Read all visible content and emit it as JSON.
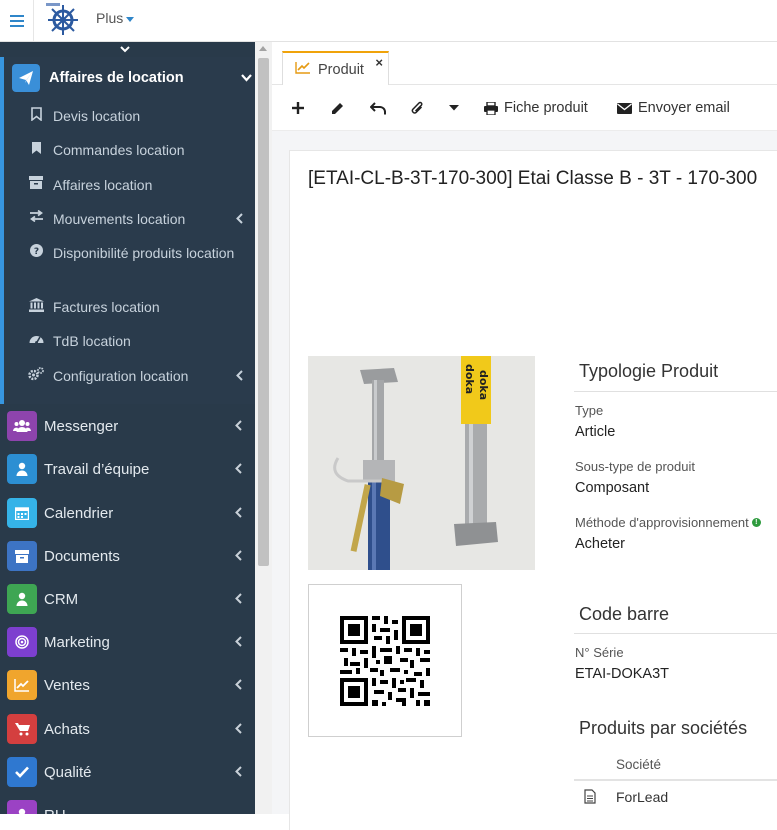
{
  "topbar": {
    "menu_icon": "hamburger-icon",
    "logo_icon": "ship-wheel-logo",
    "plus_label": "Plus"
  },
  "sidebar": {
    "active_section": {
      "label": "Affaires de location",
      "icon": "paper-plane-icon",
      "items": [
        {
          "label": "Devis location",
          "icon": "bookmark-outline-icon"
        },
        {
          "label": "Commandes location",
          "icon": "bookmark-icon"
        },
        {
          "label": "Affaires location",
          "icon": "archive-icon"
        },
        {
          "label": "Mouvements location",
          "icon": "exchange-icon",
          "has_submenu": true
        },
        {
          "label": "Disponibilité produits location",
          "icon": "question-circle-icon"
        },
        {
          "label": "Factures location",
          "icon": "bank-icon"
        },
        {
          "label": "TdB location",
          "icon": "dashboard-icon"
        },
        {
          "label": "Configuration location",
          "icon": "cogs-icon",
          "has_submenu": true
        }
      ]
    },
    "menu": [
      {
        "label": "Messenger",
        "icon": "users-icon",
        "color": "#8e44ad"
      },
      {
        "label": "Travail d’équipe",
        "icon": "user-icon",
        "color": "#2c8fd3"
      },
      {
        "label": "Calendrier",
        "icon": "calendar-icon",
        "color": "#35b3e8"
      },
      {
        "label": "Documents",
        "icon": "archive-icon",
        "color": "#3d74c4"
      },
      {
        "label": "CRM",
        "icon": "user-icon",
        "color": "#3ea653"
      },
      {
        "label": "Marketing",
        "icon": "bullseye-icon",
        "color": "#7d3fcf"
      },
      {
        "label": "Ventes",
        "icon": "line-chart-icon",
        "color": "#f0a52d"
      },
      {
        "label": "Achats",
        "icon": "cart-icon",
        "color": "#d43f3f"
      },
      {
        "label": "Qualité",
        "icon": "check-icon",
        "color": "#2f78d0"
      },
      {
        "label": "RH",
        "icon": "user-icon",
        "color": "#9b42c4"
      }
    ]
  },
  "tab": {
    "label": "Produit",
    "icon": "line-chart-icon",
    "close": "×"
  },
  "toolbar": {
    "new_icon": "plus-icon",
    "edit_icon": "pencil-icon",
    "back_icon": "undo-icon",
    "attach_icon": "paperclip-icon",
    "more_icon": "caret-down-icon",
    "print_label": "Fiche produit",
    "email_label": "Envoyer email"
  },
  "product": {
    "title": "[ETAI-CL-B-3T-170-300] Etai Classe B - 3T - 170-300",
    "photo_text_1": "doka",
    "photo_text_2": "doka"
  },
  "typologie": {
    "title": "Typologie Produit",
    "type_label": "Type",
    "type_value": "Article",
    "subtype_label": "Sous-type de produit",
    "subtype_value": "Composant",
    "method_label": "Méthode d'approvisionnement",
    "method_value": "Acheter"
  },
  "barcode": {
    "title": "Code barre",
    "serial_label": "N° Série",
    "serial_value": "ETAI-DOKA3T"
  },
  "companies": {
    "title": "Produits par sociétés",
    "col_company": "Société",
    "rows": [
      {
        "company": "ForLead"
      }
    ]
  }
}
